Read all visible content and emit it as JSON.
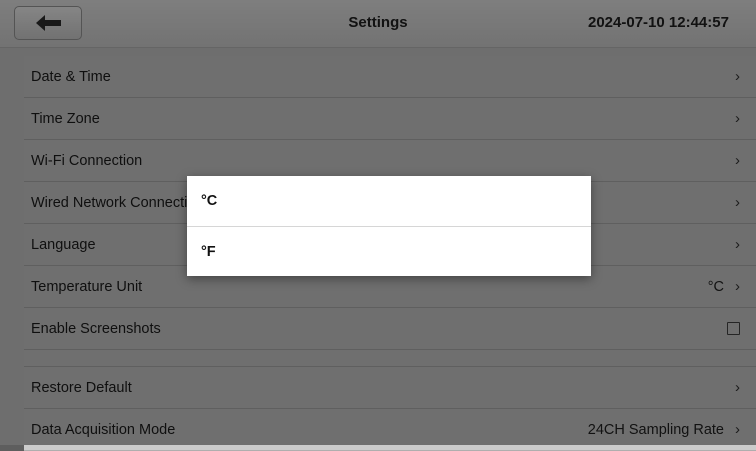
{
  "header": {
    "title": "Settings",
    "clock": "2024-07-10 12:44:57",
    "back_icon": "arrow-left-icon"
  },
  "settings": {
    "items": [
      {
        "label": "Date & Time"
      },
      {
        "label": "Time Zone"
      },
      {
        "label": "Wi-Fi Connection"
      },
      {
        "label": "Wired Network Connection"
      },
      {
        "label": "Language"
      },
      {
        "label": "Temperature Unit",
        "value": "°C"
      },
      {
        "label": "Enable Screenshots",
        "checked": false
      },
      {
        "label": "Restore Default"
      },
      {
        "label": "Data Acquisition Mode",
        "value": "24CH Sampling Rate"
      }
    ],
    "chevron": "›"
  },
  "dialog": {
    "options": [
      "°C",
      "°F"
    ]
  },
  "colors": {
    "overlay": "#000000",
    "dialog_bg": "#ffffff",
    "list_bg": "#cbcbcb"
  }
}
